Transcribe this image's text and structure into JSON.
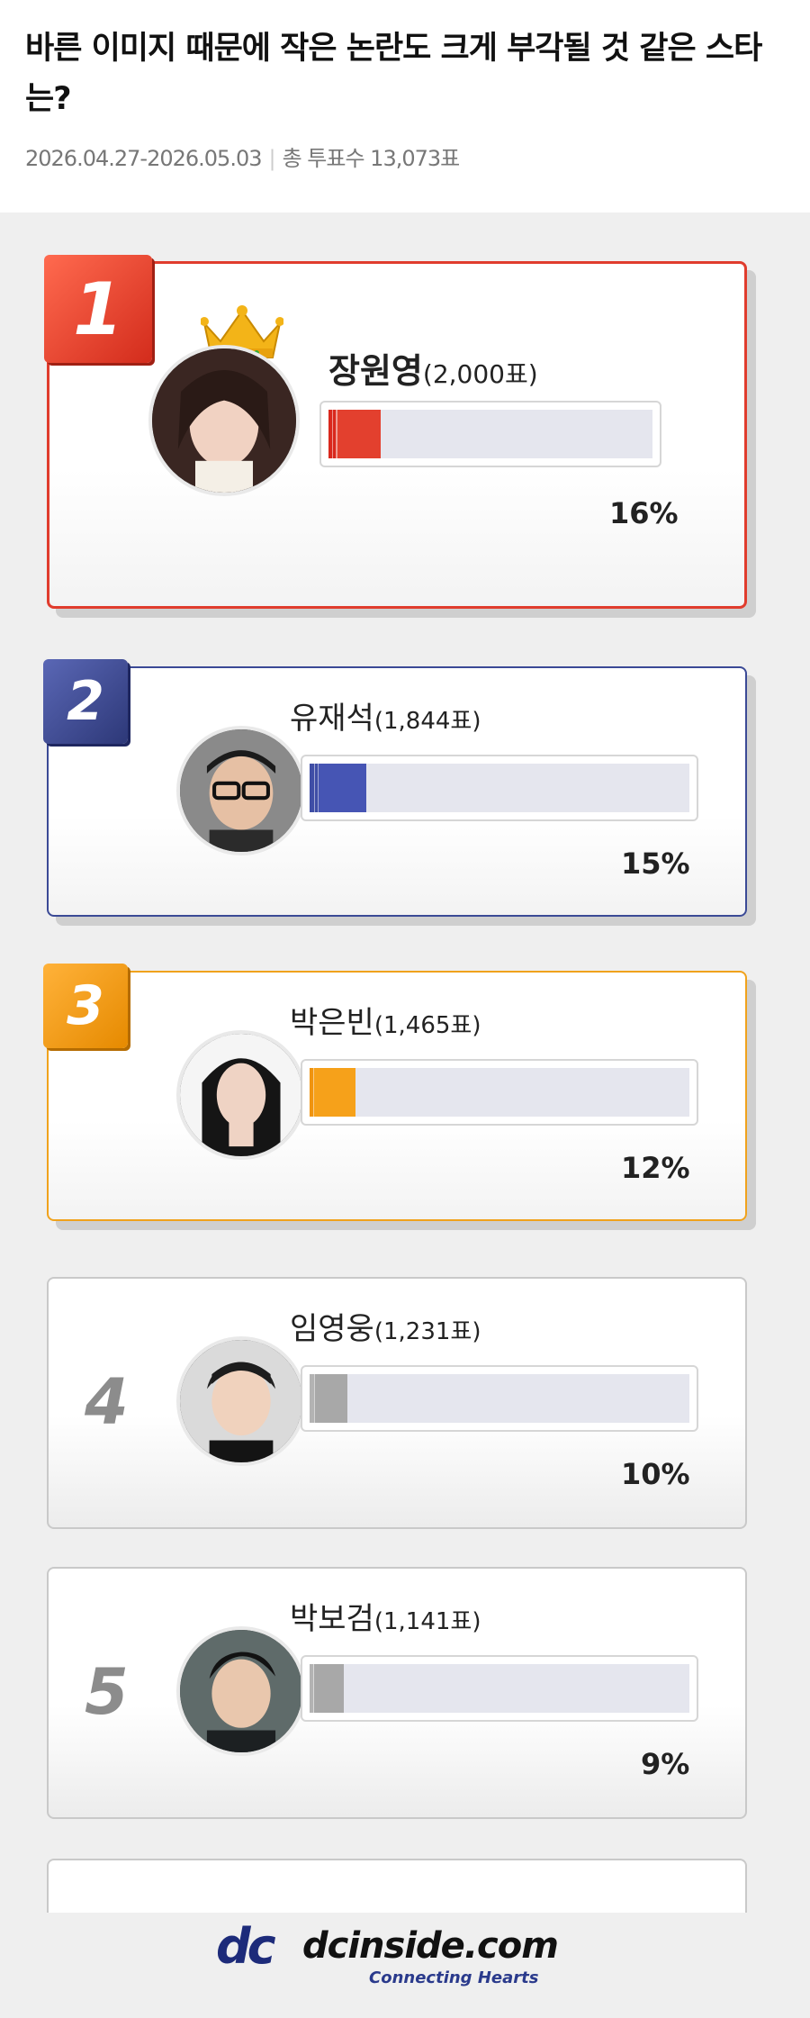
{
  "poll": {
    "title": "바른 이미지 때문에 작은 논란도 크게 부각될 것 같은 스타는?",
    "period": "2026.04.27-2026.05.03",
    "total_label": "총 투표수 13,073표"
  },
  "entries": [
    {
      "rank": "1",
      "name": "장원영",
      "votes": "(2,000표)",
      "percent": "16%",
      "value": 16,
      "color": "#e03c2d"
    },
    {
      "rank": "2",
      "name": "유재석",
      "votes": "(1,844표)",
      "percent": "15%",
      "value": 15,
      "color": "#3b4a96"
    },
    {
      "rank": "3",
      "name": "박은빈",
      "votes": "(1,465표)",
      "percent": "12%",
      "value": 12,
      "color": "#f0a21c"
    },
    {
      "rank": "4",
      "name": "임영웅",
      "votes": "(1,231표)",
      "percent": "10%",
      "value": 10,
      "color": "#b3b3b3"
    },
    {
      "rank": "5",
      "name": "박보검",
      "votes": "(1,141표)",
      "percent": "9%",
      "value": 9,
      "color": "#b3b3b3"
    }
  ],
  "footer": {
    "logo_mark": "dc",
    "logo_text": "dcinside.com",
    "tagline": "Connecting Hearts"
  }
}
